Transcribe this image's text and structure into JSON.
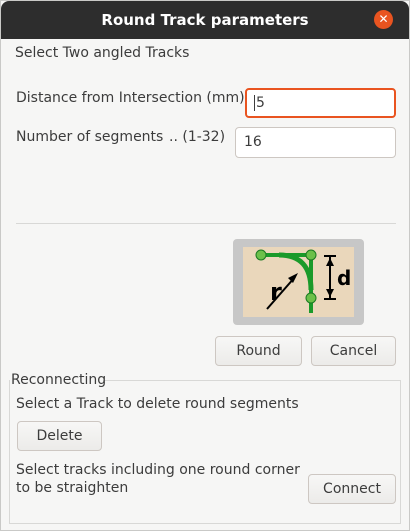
{
  "window": {
    "title": "Round Track parameters"
  },
  "parameters": {
    "instruction": "Select Two angled Tracks",
    "distance_label": "Distance from Intersection (mm)",
    "distance_value": "5",
    "segments_label": "Number of segments",
    "segments_range": "..  (1-32)",
    "segments_value": "16"
  },
  "diagram": {
    "radius_label": "r",
    "distance_label": "d",
    "colors": {
      "background": "#ead7bb",
      "track": "#1a9a2a",
      "node": "#6cc04a"
    }
  },
  "buttons": {
    "round": "Round",
    "cancel": "Cancel"
  },
  "reconnecting": {
    "group_label": "Reconnecting",
    "delete_instruction": "Select a Track to delete round segments",
    "delete_button": "Delete",
    "straighten_instruction_line1": "Select tracks including one round corner",
    "straighten_instruction_line2": "to be straighten",
    "connect_button": "Connect"
  }
}
